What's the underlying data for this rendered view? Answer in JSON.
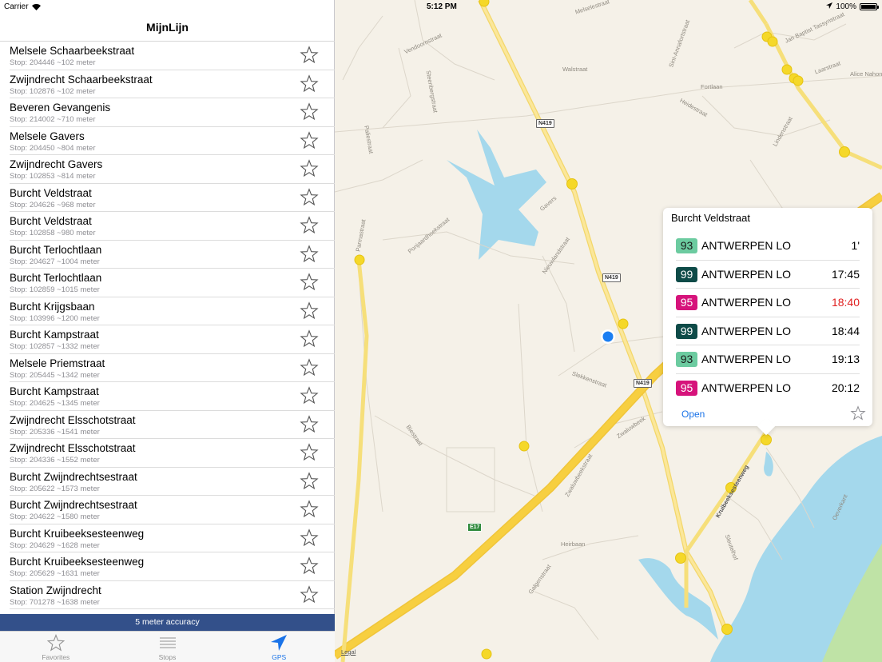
{
  "status": {
    "carrier": "Carrier",
    "time": "5:12 PM",
    "battery": "100%"
  },
  "nav": {
    "title": "MijnLijn"
  },
  "stops": [
    {
      "name": "Melsele Schaarbeekstraat",
      "meta": "Stop: 204446 ~102 meter"
    },
    {
      "name": "Zwijndrecht Schaarbeekstraat",
      "meta": "Stop: 102876 ~102 meter"
    },
    {
      "name": "Beveren Gevangenis",
      "meta": "Stop: 214002 ~710 meter"
    },
    {
      "name": "Melsele Gavers",
      "meta": "Stop: 204450 ~804 meter"
    },
    {
      "name": "Zwijndrecht Gavers",
      "meta": "Stop: 102853 ~814 meter"
    },
    {
      "name": "Burcht Veldstraat",
      "meta": "Stop: 204626 ~968 meter"
    },
    {
      "name": "Burcht Veldstraat",
      "meta": "Stop: 102858 ~980 meter"
    },
    {
      "name": "Burcht Terlochtlaan",
      "meta": "Stop: 204627 ~1004 meter"
    },
    {
      "name": "Burcht Terlochtlaan",
      "meta": "Stop: 102859 ~1015 meter"
    },
    {
      "name": "Burcht Krijgsbaan",
      "meta": "Stop: 103996 ~1200 meter"
    },
    {
      "name": "Burcht Kampstraat",
      "meta": "Stop: 102857 ~1332 meter"
    },
    {
      "name": "Melsele Priemstraat",
      "meta": "Stop: 205445 ~1342 meter"
    },
    {
      "name": "Burcht Kampstraat",
      "meta": "Stop: 204625 ~1345 meter"
    },
    {
      "name": "Zwijndrecht Elsschotstraat",
      "meta": "Stop: 205336 ~1541 meter"
    },
    {
      "name": "Zwijndrecht Elsschotstraat",
      "meta": "Stop: 204336 ~1552 meter"
    },
    {
      "name": "Burcht Zwijndrechtsestraat",
      "meta": "Stop: 205622 ~1573 meter"
    },
    {
      "name": "Burcht Zwijndrechtsestraat",
      "meta": "Stop: 204622 ~1580 meter"
    },
    {
      "name": "Burcht Kruibeeksesteenweg",
      "meta": "Stop: 204629 ~1628 meter"
    },
    {
      "name": "Burcht Kruibeeksesteenweg",
      "meta": "Stop: 205629 ~1631 meter"
    },
    {
      "name": "Station Zwijndrecht",
      "meta": "Stop: 701278 ~1638 meter"
    }
  ],
  "accuracy": "5 meter accuracy",
  "tabs": [
    {
      "label": "Favorites",
      "icon": "star-icon"
    },
    {
      "label": "Stops",
      "icon": "list-icon"
    },
    {
      "label": "GPS",
      "icon": "location-arrow-icon"
    }
  ],
  "map": {
    "legal": "Legal",
    "labels": {
      "melselestraat": "Melselestraat",
      "vendoornstraat": "Vendoornstraat",
      "walstraat": "Walstraat",
      "fortlaan": "Fortlaan",
      "heidestraat": "Heidestraat",
      "laarstraat": "Laarstraat",
      "alice_nahon": "Alice Nahon",
      "jan_baptist": "Jan Baptist Tassynstraat",
      "lindenstraat": "Lindenstraat",
      "steenbergstraat": "Steenbergstraat",
      "paliestraat": "Paliestraat",
      "gavers": "Gavers",
      "parmastraat": "Parmastraat",
      "ponjaardhoekstraat": "Ponjaardhoekstraat",
      "nieuwlandstraat": "Nieuwlandstraat",
      "slekkenstraat": "Slekkenstraat",
      "biestraat": "Biestraat",
      "zwaluwbeek": "Zwaluwbeek",
      "zwaluwbeekstraat": "Zwaluwbeekstraat",
      "heirbaan": "Heirbaan",
      "galgenstraat": "Galgenstraat",
      "kruibeeksesteenweg": "Kruibeeksesteenweg",
      "sleutelhof": "Sleutelhof",
      "oeverkant": "Oeverkant",
      "sint_annafort": "Sint-Annafortstraat"
    },
    "shields": {
      "n419": "N419",
      "e17": "E17"
    }
  },
  "popover": {
    "title": "Burcht Veldstraat",
    "departures": [
      {
        "line": "93",
        "dest": "ANTWERPEN LO",
        "time": "1'",
        "color": "#6ccba0",
        "textColor": "#1a1a1a",
        "late": false
      },
      {
        "line": "99",
        "dest": "ANTWERPEN LO",
        "time": "17:45",
        "color": "#0e4b48",
        "textColor": "#ffffff",
        "late": false
      },
      {
        "line": "95",
        "dest": "ANTWERPEN LO",
        "time": "18:40",
        "color": "#d6137b",
        "textColor": "#ffffff",
        "late": true
      },
      {
        "line": "99",
        "dest": "ANTWERPEN LO",
        "time": "18:44",
        "color": "#0e4b48",
        "textColor": "#ffffff",
        "late": false
      },
      {
        "line": "93",
        "dest": "ANTWERPEN LO",
        "time": "19:13",
        "color": "#6ccba0",
        "textColor": "#1a1a1a",
        "late": false
      },
      {
        "line": "95",
        "dest": "ANTWERPEN LO",
        "time": "20:12",
        "color": "#d6137b",
        "textColor": "#ffffff",
        "late": false
      }
    ],
    "open_label": "Open"
  },
  "colors": {
    "accent": "#1a73e8",
    "accuracy_bar": "#33508a",
    "late": "#e02020",
    "water": "#a4d8ec",
    "highway": "#f7cf40"
  }
}
